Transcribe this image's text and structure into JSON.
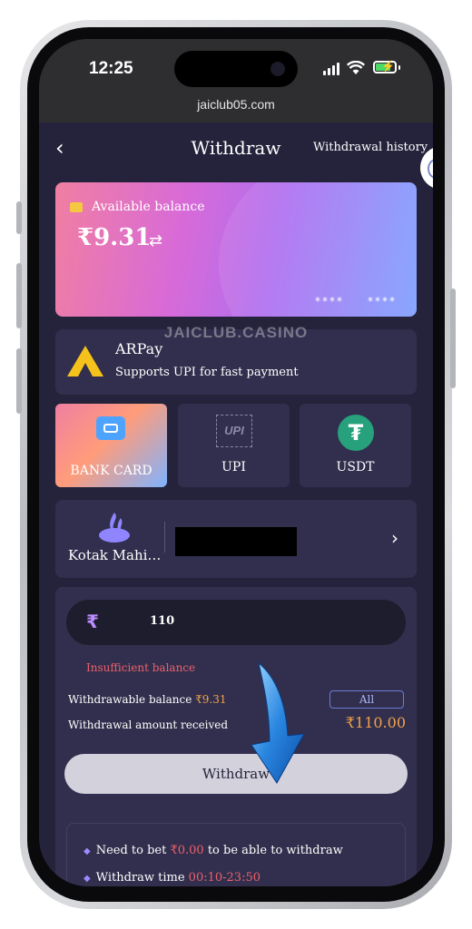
{
  "status_bar": {
    "time": "12:25",
    "url": "jaiclub05.com"
  },
  "header": {
    "back_icon": "‹",
    "title": "Withdraw",
    "history_label": "Withdrawal history"
  },
  "balance_card": {
    "label": "Available balance",
    "amount": "₹9.31",
    "card_mask_1": "****",
    "card_mask_2": "****"
  },
  "watermark": "JAICLUB.CASINO",
  "arpay": {
    "name": "ARPay",
    "description": "Supports UPI for fast payment"
  },
  "methods": [
    {
      "label": "BANK CARD",
      "icon": "bank-card-icon",
      "selected": true
    },
    {
      "label": "UPI",
      "icon": "upi-icon",
      "selected": false
    },
    {
      "label": "USDT",
      "icon": "usdt-icon",
      "selected": false
    }
  ],
  "bank": {
    "name": "Kotak Mahi…"
  },
  "amount_input": {
    "currency": "₹",
    "value": "110"
  },
  "warning": "Insufficient balance",
  "withdrawable": {
    "label": "Withdrawable balance ",
    "value": "₹9.31"
  },
  "all_label": "All",
  "received": {
    "label": "Withdrawal amount received",
    "value": "₹110.00"
  },
  "withdraw_button": "Withdraw",
  "rules": [
    {
      "prefix": "Need to bet ",
      "highlight": "₹0.00",
      "suffix": " to be able to withdraw"
    },
    {
      "prefix": "Withdraw time ",
      "highlight": "00:10-23:50",
      "suffix": ""
    }
  ],
  "colors": {
    "background": "#25233b",
    "panel": "#312f4d",
    "accent_orange": "#f3a24b",
    "warning_red": "#f0606a"
  }
}
